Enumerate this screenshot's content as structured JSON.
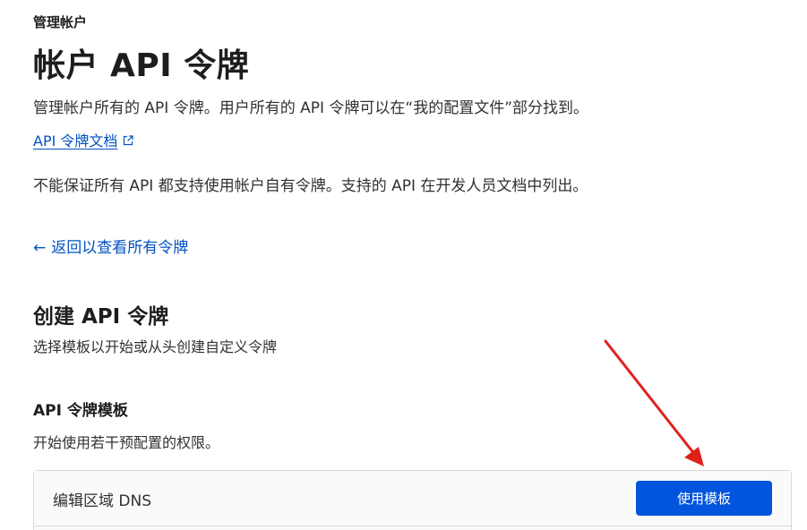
{
  "header": {
    "breadcrumb": "管理帐户",
    "title": "帐户 API 令牌",
    "description": "管理帐户所有的 API 令牌。用户所有的 API 令牌可以在“我的配置文件”部分找到。",
    "doc_link": "API 令牌文档",
    "notice": "不能保证所有 API 都支持使用帐户自有令牌。支持的 API 在开发人员文档中列出。"
  },
  "nav": {
    "back_arrow": "←",
    "back_label": "返回以查看所有令牌"
  },
  "create": {
    "title": "创建 API 令牌",
    "subtitle": "选择模板以开始或从头创建自定义令牌"
  },
  "templates": {
    "title": "API 令牌模板",
    "subtitle": "开始使用若干预配置的权限。",
    "items": [
      {
        "name": "编辑区域 DNS",
        "button": "使用模板"
      }
    ]
  },
  "icons": {
    "external_link": "external-link-icon",
    "back_arrow": "arrow-left-icon"
  },
  "colors": {
    "link": "#0051c3",
    "primary_button": "#0055dc",
    "annotation_arrow": "#e0201b"
  }
}
